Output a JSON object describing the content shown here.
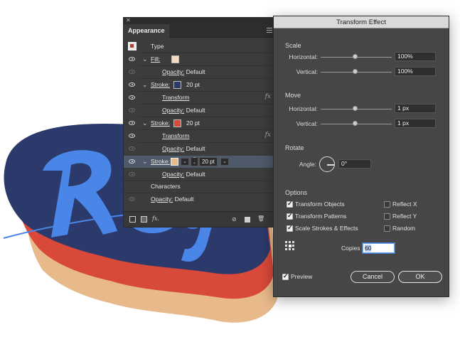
{
  "appearance": {
    "tab_label": "Appearance",
    "rows": [
      {
        "label": "Type"
      },
      {
        "label": "Fill:"
      },
      {
        "label": "Opacity:",
        "value": "Default"
      },
      {
        "label": "Stroke:",
        "value": "20 pt"
      },
      {
        "label": "Transform"
      },
      {
        "label": "Opacity:",
        "value": "Default"
      },
      {
        "label": "Stroke:",
        "value": "20 pt"
      },
      {
        "label": "Transform"
      },
      {
        "label": "Opacity:",
        "value": "Default"
      },
      {
        "label": "Stroke:",
        "value": "20 pt"
      },
      {
        "label": "Opacity:",
        "value": "Default"
      },
      {
        "label": "Characters"
      },
      {
        "label": "Opacity:",
        "value": "Default"
      }
    ],
    "colors": {
      "fill_swatch": "#f1dcc0",
      "stroke1_swatch": "#2c3a6b",
      "stroke2_swatch": "#d9493a",
      "stroke3_swatch": "#e8b98a"
    }
  },
  "dialog": {
    "title": "Transform Effect",
    "scale": {
      "title": "Scale",
      "horizontal_label": "Horizontal:",
      "horizontal_value": "100%",
      "vertical_label": "Vertical:",
      "vertical_value": "100%"
    },
    "move": {
      "title": "Move",
      "horizontal_label": "Horizontal:",
      "horizontal_value": "1 px",
      "vertical_label": "Vertical:",
      "vertical_value": "1 px"
    },
    "rotate": {
      "title": "Rotate",
      "angle_label": "Angle:",
      "angle_value": "0°"
    },
    "options": {
      "title": "Options",
      "transform_objects": "Transform Objects",
      "transform_patterns": "Transform Patterns",
      "scale_strokes": "Scale Strokes & Effects",
      "reflect_x": "Reflect X",
      "reflect_y": "Reflect Y",
      "random": "Random",
      "copies_label": "Copies",
      "copies_value": "60"
    },
    "preview_label": "Preview",
    "cancel_label": "Cancel",
    "ok_label": "OK"
  },
  "artwork": {
    "colors": {
      "blue": "#4a86e8",
      "navy": "#2c3a6b",
      "red": "#d9493a",
      "tan": "#e8b98a"
    }
  }
}
